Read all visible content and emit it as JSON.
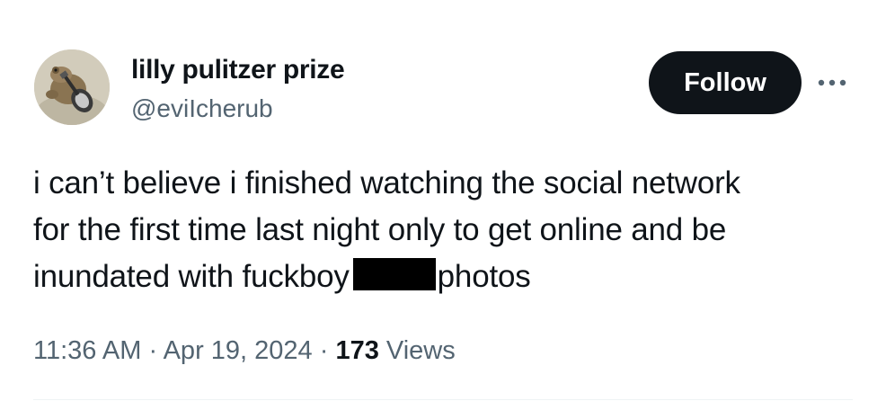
{
  "author": {
    "display_name": "lilly pulitzer prize",
    "handle": "@eviIcherub",
    "avatar_icon": "frog-with-guitar-avatar"
  },
  "actions": {
    "follow_label": "Follow",
    "more_icon": "more-options-icon"
  },
  "tweet": {
    "line1": "i can’t believe i finished watching the social network",
    "line2": "for the first time last night only to get online and be",
    "line3_before": "inundated with fuckboy",
    "line3_after": "photos",
    "redacted": true
  },
  "meta": {
    "time": "11:36 AM",
    "separator": "·",
    "date": "Apr 19, 2024",
    "views_count": "173",
    "views_label": "Views"
  },
  "colors": {
    "text": "#0f1419",
    "secondary": "#536471",
    "button_bg": "#0f1419",
    "button_text": "#ffffff"
  }
}
